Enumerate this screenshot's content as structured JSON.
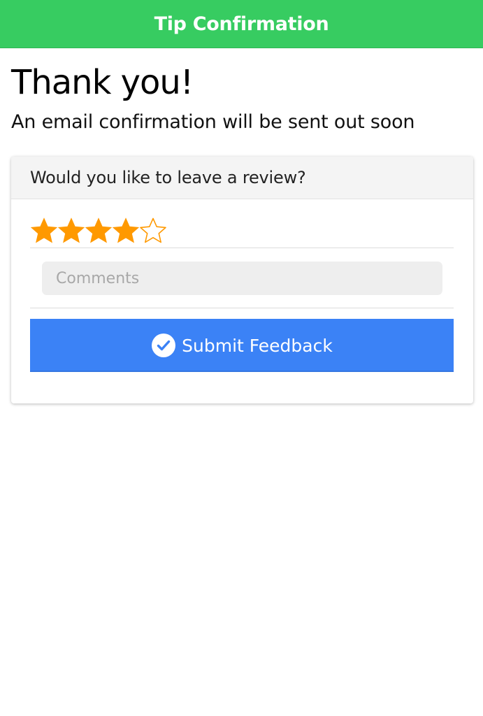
{
  "header": {
    "title": "Tip Confirmation",
    "color": "#37cc61"
  },
  "main": {
    "heading": "Thank you!",
    "subtitle": "An email confirmation will be sent out soon"
  },
  "review_card": {
    "title": "Would you like to leave a review?",
    "rating": {
      "value": 4,
      "max": 5,
      "filled_color": "#ff9900",
      "empty_color": "#ff9900",
      "icon": "star-icon"
    },
    "comments": {
      "placeholder": "Comments",
      "value": ""
    },
    "submit": {
      "label": "Submit Feedback",
      "icon": "check-circle-icon",
      "color": "#3b82f6"
    }
  }
}
